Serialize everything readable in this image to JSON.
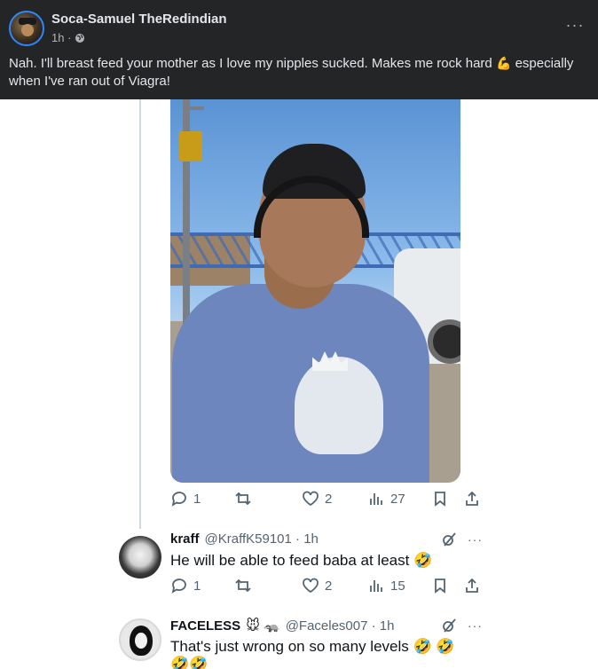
{
  "post": {
    "author": "Soca-Samuel TheRedindian",
    "time": "1h ·",
    "text": "Nah. I'll breast feed your mother as I love my nipples sucked. Makes me rock hard",
    "emoji_flex": "💪",
    "text_cont": "especially when I've ran out of Viagra!",
    "more": "···"
  },
  "tweet": {
    "stats": {
      "replies": "1",
      "retweets": "",
      "likes": "2",
      "views": "27"
    }
  },
  "replies": [
    {
      "name": "kraff",
      "handle": "@KraffK59101 · 1h",
      "text": "He will be able to feed baba at least",
      "emoji": "🤣",
      "stats": {
        "replies": "1",
        "retweets": "",
        "likes": "2",
        "views": "15"
      }
    },
    {
      "name": "FACELESS",
      "name_emoji": "🐭 🦡",
      "handle": "@Faceles007 · 1h",
      "text": "That's just wrong on so many levels",
      "emoji": "🤣 🤣",
      "emoji_line2": "🤣🤣"
    }
  ],
  "colors": {
    "fb_bg": "#242526",
    "x_text": "#0f1419",
    "x_muted": "#536471",
    "thread": "#cfd9de"
  }
}
